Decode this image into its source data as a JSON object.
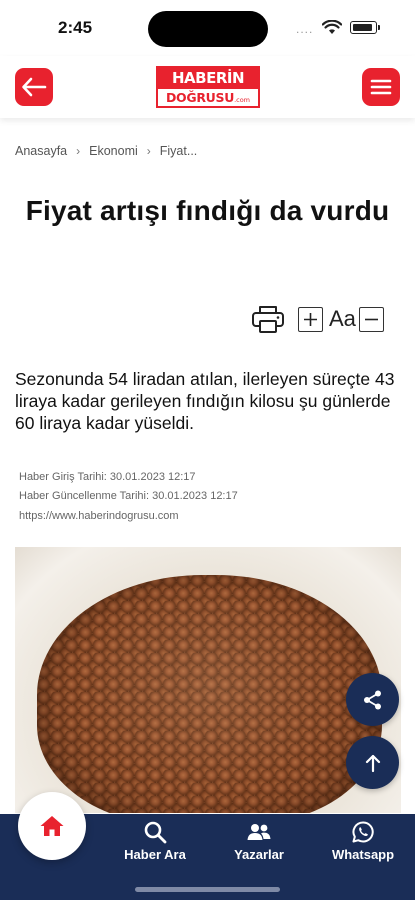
{
  "status_bar": {
    "time": "2:45",
    "dots": "...."
  },
  "header": {
    "logo_top": "HABERİN",
    "logo_bottom": "DOĞRUSU",
    "logo_suffix": ".com",
    "back_icon": "arrow-left-icon",
    "menu_icon": "hamburger-menu-icon",
    "accent_color": "#e8222e"
  },
  "breadcrumb": {
    "items": [
      "Anasayfa",
      "Ekonomi",
      "Fiyat..."
    ]
  },
  "article": {
    "title": "Fiyat artışı fındığı da vurdu",
    "font_label": "Aa",
    "summary": "Sezonunda 54 liradan atılan, ilerleyen süreçte 43 liraya kadar gerileyen fındığın kilosu şu günlerde 60 liraya kadar yüseldi.",
    "created": "Haber Giriş Tarihi: 30.01.2023 12:17",
    "updated": "Haber Güncellenme Tarihi: 30.01.2023 12:17",
    "url": "https://www.haberindogrusu.com",
    "image_subject": "hazelnuts-in-sack"
  },
  "fabs": {
    "share_icon": "share-icon",
    "top_icon": "arrow-up-icon"
  },
  "bottom_nav": {
    "bg_color": "#1a2d57",
    "items": [
      {
        "label": "Haber Ara",
        "icon": "search-icon"
      },
      {
        "label": "Yazarlar",
        "icon": "users-icon"
      },
      {
        "label": "Whatsapp",
        "icon": "whatsapp-icon"
      }
    ],
    "home_icon": "home-icon"
  }
}
